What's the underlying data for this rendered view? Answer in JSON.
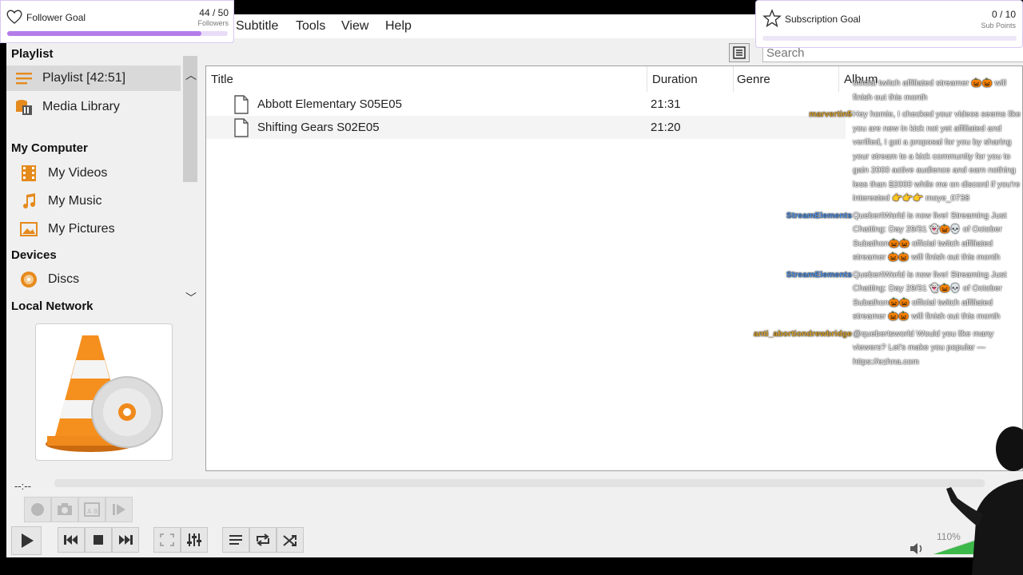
{
  "menu": [
    "Subtitle",
    "Tools",
    "View",
    "Help"
  ],
  "search": {
    "placeholder": "Search"
  },
  "sidebar": {
    "playlist_heading": "Playlist",
    "playlist_item": "Playlist [42:51]",
    "media_library": "Media Library",
    "my_computer_heading": "My Computer",
    "my_videos": "My Videos",
    "my_music": "My Music",
    "my_pictures": "My Pictures",
    "devices_heading": "Devices",
    "discs": "Discs",
    "local_network_heading": "Local Network"
  },
  "playlist": {
    "columns": [
      "Title",
      "Duration",
      "Genre",
      "Album"
    ],
    "rows": [
      {
        "title": "Abbott Elementary S05E05",
        "duration": "21:31"
      },
      {
        "title": "Shifting Gears S02E05",
        "duration": "21:20"
      }
    ]
  },
  "player": {
    "elapsed": "--:--",
    "volume": "110%",
    "seek_progress": 0
  },
  "follower_goal": {
    "title": "Follower Goal",
    "count": "44 / 50",
    "unit": "Followers",
    "progress": 0.88
  },
  "subscription_goal": {
    "title": "Subscription Goal",
    "count": "0 / 10",
    "unit": "Sub Points",
    "progress": 0
  },
  "chat": [
    {
      "user": "",
      "text": "official twitch affiliated streamer 🎃🎃 will finish out this month"
    },
    {
      "user": "marvertin5",
      "text": "Hey homie, I checked your videos seems like you are new in kick not yet affiliated and verified, I got a proposal for you by sharing your stream to a kick community for you to gain 2000 active audience and earn nothing less than $2000 while me on discord if you're interested 👉👉👉 moye_0738"
    },
    {
      "user": "StreamElements",
      "text": "QuebertWorld is now live! Streaming Just Chatting: Day 29/31 👻🎃💀 of October Subathon🎃🎃 official twitch affiliated streamer 🎃🎃 will finish out this month"
    },
    {
      "user": "StreamElements",
      "text": "QuebertWorld is now live! Streaming Just Chatting: Day 29/31 👻🎃💀 of October Subathon🎃🎃 official twitch affiliated streamer 🎃🎃 will finish out this month"
    },
    {
      "user": "anti_abortiondrewbridge",
      "text": "@quebertsworld Would you like many viewers? Let's make you popular — https://ezhna.com"
    }
  ],
  "colors": {
    "goal_accent": "#b57be8",
    "vlc_orange": "#f08a1c",
    "chat_user_green": "#d8a12a",
    "chat_user_blue": "#4a8be0"
  }
}
